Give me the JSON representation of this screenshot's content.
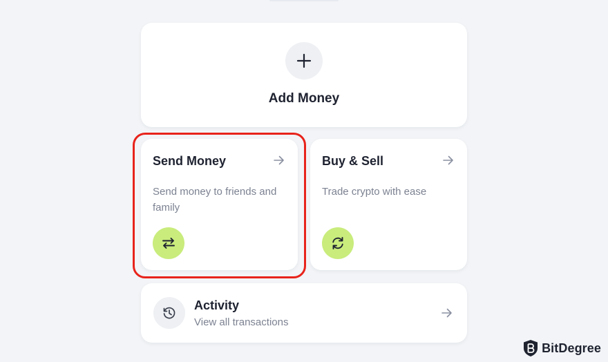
{
  "add_money": {
    "label": "Add Money",
    "icon": "plus-icon"
  },
  "cards": {
    "send": {
      "title": "Send Money",
      "description": "Send money to friends and family",
      "icon": "swap-arrows-icon",
      "arrow_icon": "arrow-right-icon",
      "icon_bg": "#c9ec7c",
      "highlighted": true,
      "highlight_color": "#e8231b"
    },
    "buy_sell": {
      "title": "Buy & Sell",
      "description": "Trade crypto with ease",
      "icon": "refresh-icon",
      "arrow_icon": "arrow-right-icon",
      "icon_bg": "#c9ec7c"
    }
  },
  "activity": {
    "title": "Activity",
    "subtitle": "View all transactions",
    "icon": "history-icon",
    "arrow_icon": "arrow-right-icon"
  },
  "watermark": {
    "text": "BitDegree",
    "icon": "bitdegree-logo-icon"
  }
}
